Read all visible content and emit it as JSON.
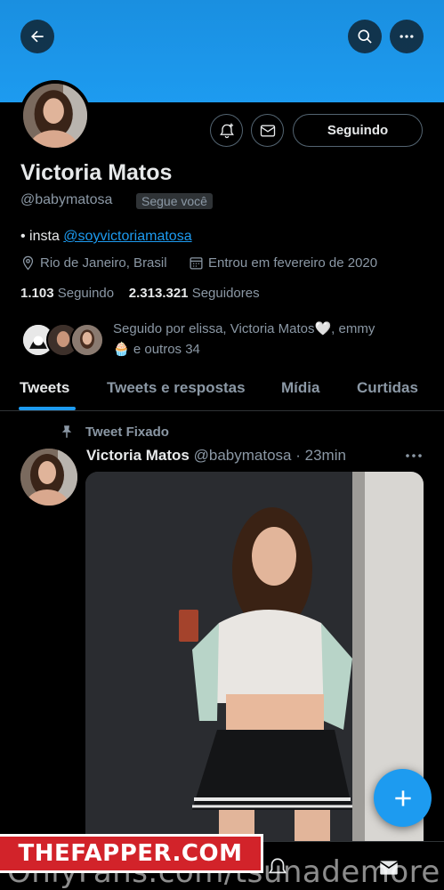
{
  "profile": {
    "name": "Victoria Matos",
    "handle": "@babymatosa",
    "follows_you": "Segue você",
    "bio_prefix": "• insta ",
    "bio_link": "@soyvictoriamatosa",
    "location": "Rio de Janeiro, Brasil",
    "joined": "Entrou em fevereiro de 2020",
    "following_count": "1.103",
    "following_label": "Seguindo",
    "followers_count": "2.313.321",
    "followers_label": "Seguidores",
    "followed_by_line1": "Seguido por elissa, Victoria Matos🤍, emmy",
    "followed_by_line2": "🧁 e outros 34"
  },
  "actions": {
    "follow_button": "Seguindo"
  },
  "tabs": [
    "Tweets",
    "Tweets e respostas",
    "Mídia",
    "Curtidas"
  ],
  "tweet": {
    "pinned_label": "Tweet Fixado",
    "author_name": "Victoria Matos",
    "author_handle": "@babymatosa",
    "time": "· 23min"
  },
  "watermark": {
    "brand": "THEFAPPER.COM",
    "text": "OnlyFans.com/tsunademore"
  },
  "colors": {
    "accent": "#1d9bf0",
    "background": "#000000",
    "secondary_text": "#8b98a5",
    "watermark_red": "#d2232a"
  }
}
